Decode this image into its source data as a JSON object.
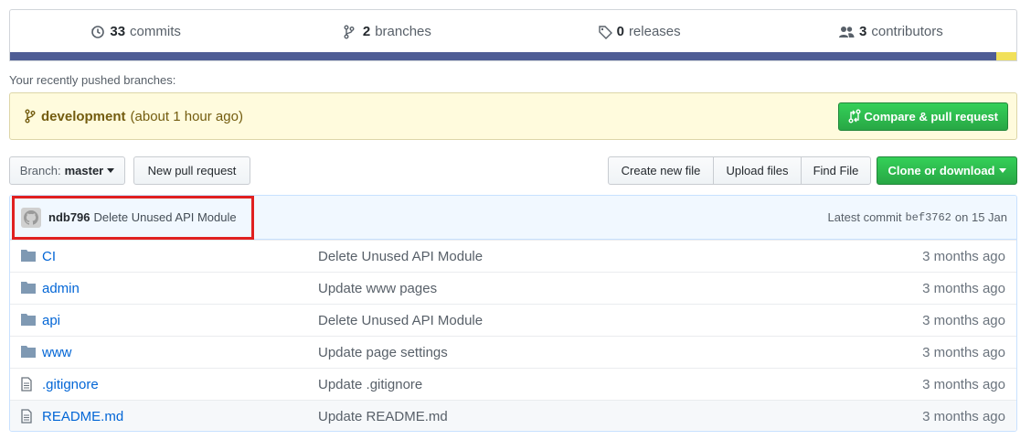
{
  "summary": {
    "commits": {
      "count": "33",
      "label": "commits",
      "icon": "history-icon"
    },
    "branches": {
      "count": "2",
      "label": "branches",
      "icon": "branch-icon"
    },
    "releases": {
      "count": "0",
      "label": "releases",
      "icon": "tag-icon"
    },
    "contributors": {
      "count": "3",
      "label": "contributors",
      "icon": "people-icon"
    }
  },
  "language_bar": [
    {
      "percent": 98,
      "color": "#4F5D95"
    },
    {
      "percent": 2,
      "color": "#F1E05A"
    }
  ],
  "recent": {
    "label": "Your recently pushed branches:",
    "branch": "development",
    "time": "(about 1 hour ago)",
    "compare_label": "Compare & pull request"
  },
  "toolbar": {
    "branch_prefix": "Branch:",
    "branch_name": "master",
    "new_pr": "New pull request",
    "create_file": "Create new file",
    "upload_files": "Upload files",
    "find_file": "Find File",
    "clone": "Clone or download"
  },
  "commit": {
    "author": "ndb796",
    "message": "Delete Unused API Module",
    "latest_label": "Latest commit",
    "sha": "bef3762",
    "date": "on 15 Jan"
  },
  "files": [
    {
      "name": "CI",
      "type": "folder",
      "message": "Delete Unused API Module",
      "age": "3 months ago"
    },
    {
      "name": "admin",
      "type": "folder",
      "message": "Update www pages",
      "age": "3 months ago"
    },
    {
      "name": "api",
      "type": "folder",
      "message": "Delete Unused API Module",
      "age": "3 months ago"
    },
    {
      "name": "www",
      "type": "folder",
      "message": "Update page settings",
      "age": "3 months ago"
    },
    {
      "name": ".gitignore",
      "type": "file",
      "message": "Update .gitignore",
      "age": "3 months ago"
    },
    {
      "name": "README.md",
      "type": "file",
      "message": "Update README.md",
      "age": "3 months ago"
    }
  ],
  "colors": {
    "accent_green": "#28a745",
    "link_blue": "#0366d6",
    "highlight_red": "#e02020"
  }
}
